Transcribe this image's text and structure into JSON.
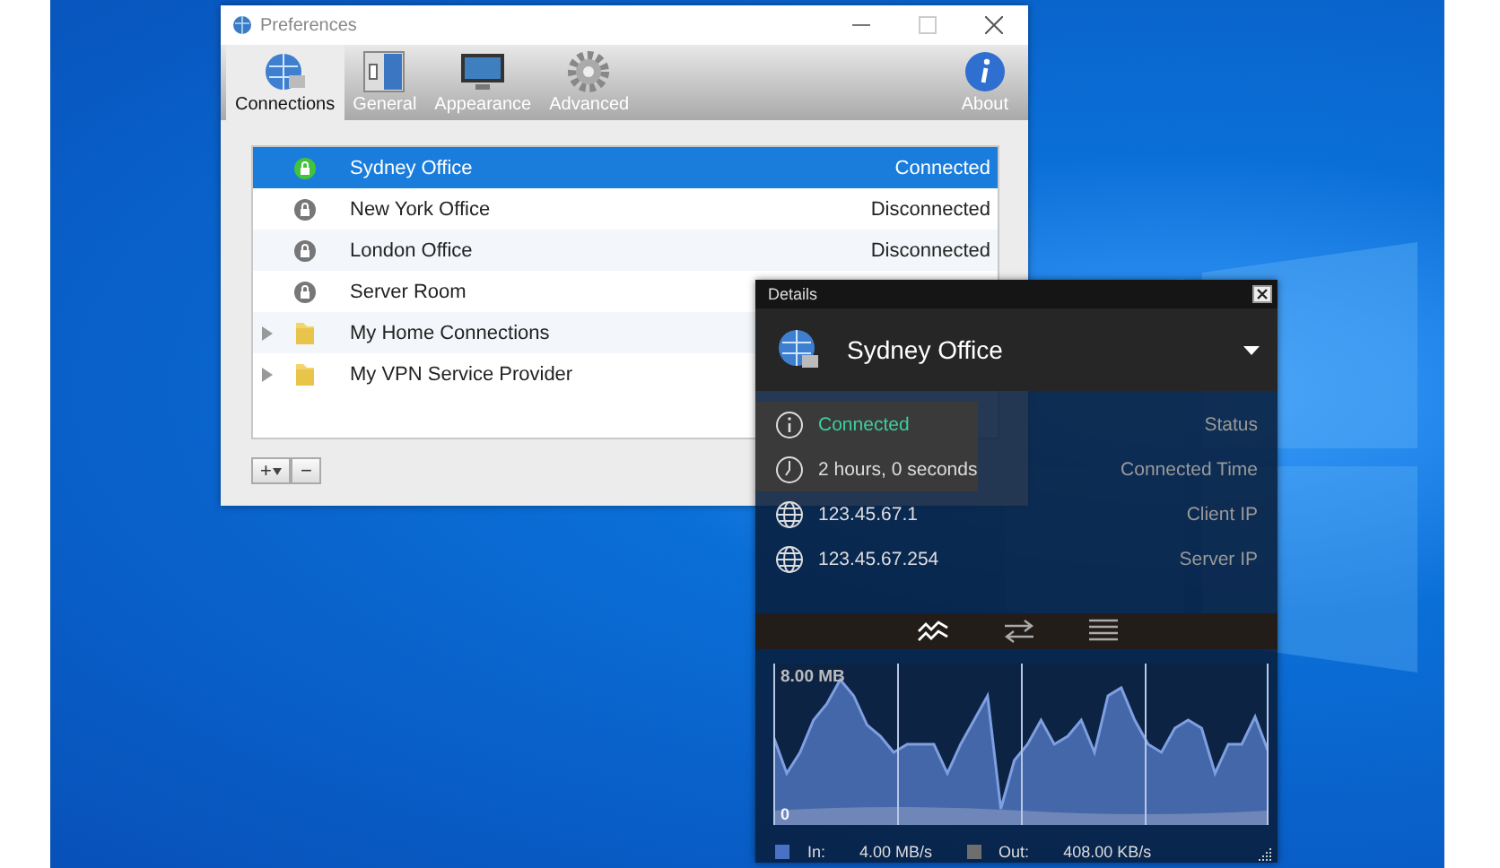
{
  "preferences": {
    "title": "Preferences",
    "tabs": [
      {
        "kind": "connections",
        "label": "Connections",
        "selected": true
      },
      {
        "kind": "general",
        "label": "General",
        "selected": false
      },
      {
        "kind": "appearance",
        "label": "Appearance",
        "selected": false
      },
      {
        "kind": "advanced",
        "label": "Advanced",
        "selected": false
      },
      {
        "kind": "about",
        "label": "About",
        "selected": false
      }
    ],
    "connections": [
      {
        "kind": "connection",
        "name": "Sydney Office",
        "status": "Connected",
        "connected": true,
        "selected": true
      },
      {
        "kind": "connection",
        "name": "New York Office",
        "status": "Disconnected",
        "connected": false,
        "selected": false
      },
      {
        "kind": "connection",
        "name": "London Office",
        "status": "Disconnected",
        "connected": false,
        "selected": false
      },
      {
        "kind": "connection",
        "name": "Server Room",
        "connected": false,
        "selected": false
      },
      {
        "kind": "folder",
        "name": "My Home Connections",
        "selected": false
      },
      {
        "kind": "folder",
        "name": "My VPN Service Provider",
        "selected": false
      }
    ],
    "buttons": [
      "+",
      "−"
    ]
  },
  "details": {
    "title": "Details",
    "connection_name": "Sydney Office",
    "rows": [
      {
        "kind": "status",
        "value": "Connected",
        "label": "Status",
        "highlighted": true
      },
      {
        "kind": "time",
        "value": "2 hours, 0 seconds",
        "label": "Connected Time",
        "highlighted": true
      },
      {
        "kind": "ip",
        "value": "123.45.67.1",
        "label": "Client IP",
        "highlighted": false
      },
      {
        "kind": "ip",
        "value": "123.45.67.254",
        "label": "Server IP",
        "highlighted": false
      }
    ],
    "views": [
      {
        "kind": "graph",
        "selected": true
      },
      {
        "kind": "transfer",
        "selected": false
      },
      {
        "kind": "list",
        "selected": false
      }
    ],
    "graph": {
      "max_label": "8.00 MB",
      "min_label": "0"
    },
    "legend": [
      {
        "label": "In:",
        "value": "4.00 MB/s",
        "color": "#4a72c4"
      },
      {
        "label": "Out:",
        "value": "408.00 KB/s",
        "color": "#6e6e6e"
      }
    ]
  }
}
